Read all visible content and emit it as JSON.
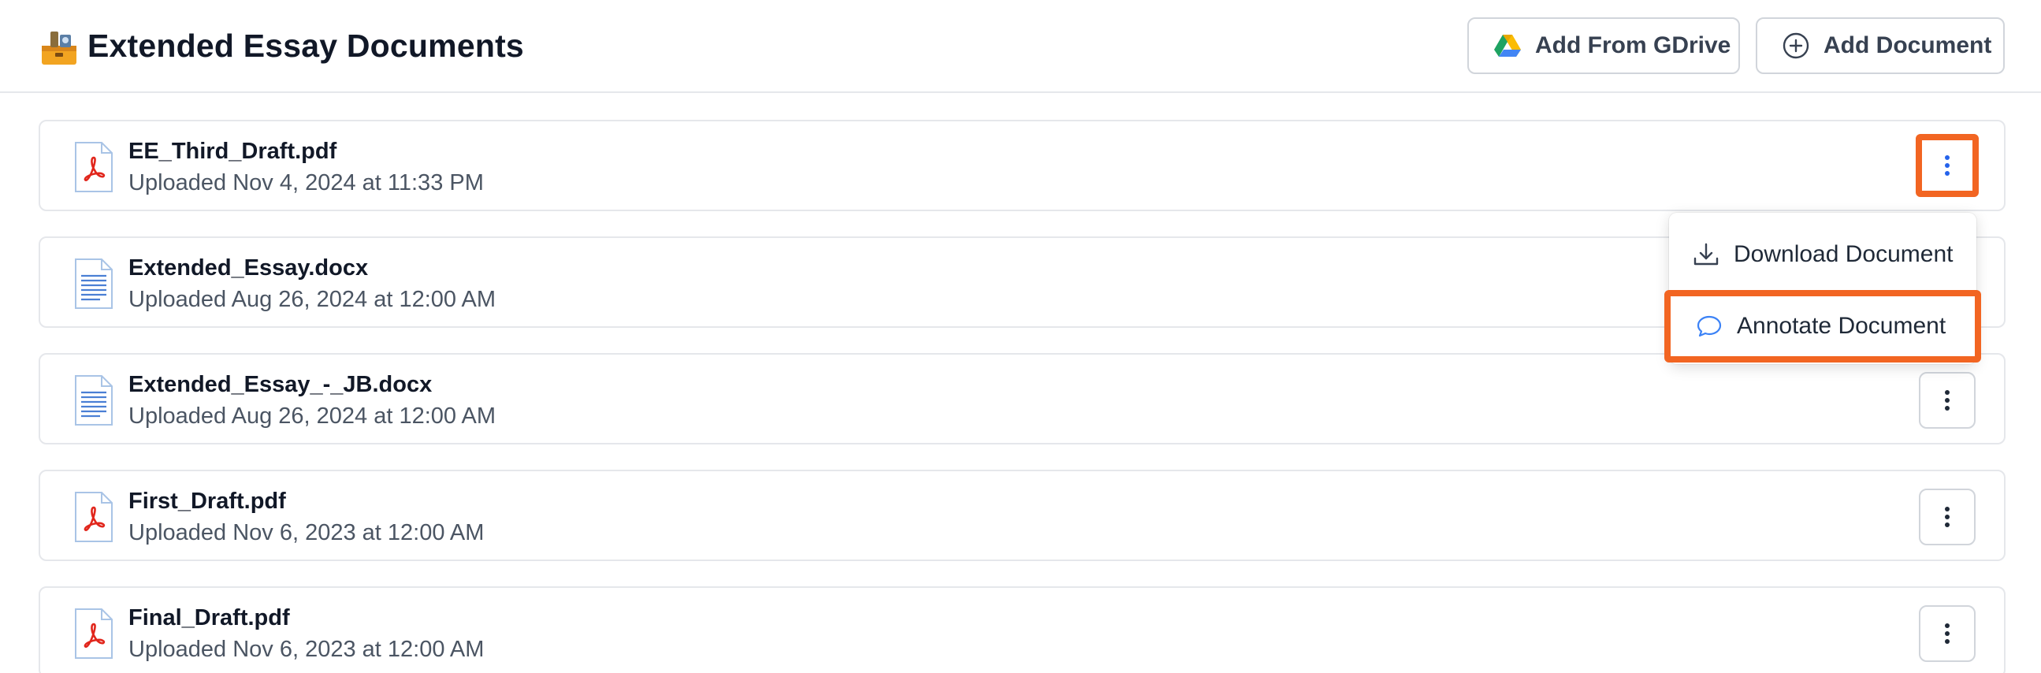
{
  "header": {
    "title": "Extended Essay Documents",
    "title_icon": "toolbox-emoji-icon",
    "buttons": {
      "gdrive_label": "Add From GDrive",
      "add_label": "Add Document"
    }
  },
  "documents": [
    {
      "name": "EE_Third_Draft.pdf",
      "uploaded": "Uploaded Nov 4, 2024 at 11:33 PM",
      "type": "pdf"
    },
    {
      "name": "Extended_Essay.docx",
      "uploaded": "Uploaded Aug 26, 2024 at 12:00 AM",
      "type": "docx"
    },
    {
      "name": "Extended_Essay_-_JB.docx",
      "uploaded": "Uploaded Aug 26, 2024 at 12:00 AM",
      "type": "docx"
    },
    {
      "name": "First_Draft.pdf",
      "uploaded": "Uploaded Nov 6, 2023 at 12:00 AM",
      "type": "pdf"
    },
    {
      "name": "Final_Draft.pdf",
      "uploaded": "Uploaded Nov 6, 2023 at 12:00 AM",
      "type": "pdf"
    }
  ],
  "menu": {
    "items": [
      {
        "label": "Download Document",
        "icon": "download-icon"
      },
      {
        "label": "Annotate Document",
        "icon": "comment-icon"
      }
    ]
  },
  "colors": {
    "highlight": "#f26522",
    "pdf_red": "#e1261c",
    "docx_blue": "#4a7fd4",
    "kebab_active": "#2563eb"
  }
}
